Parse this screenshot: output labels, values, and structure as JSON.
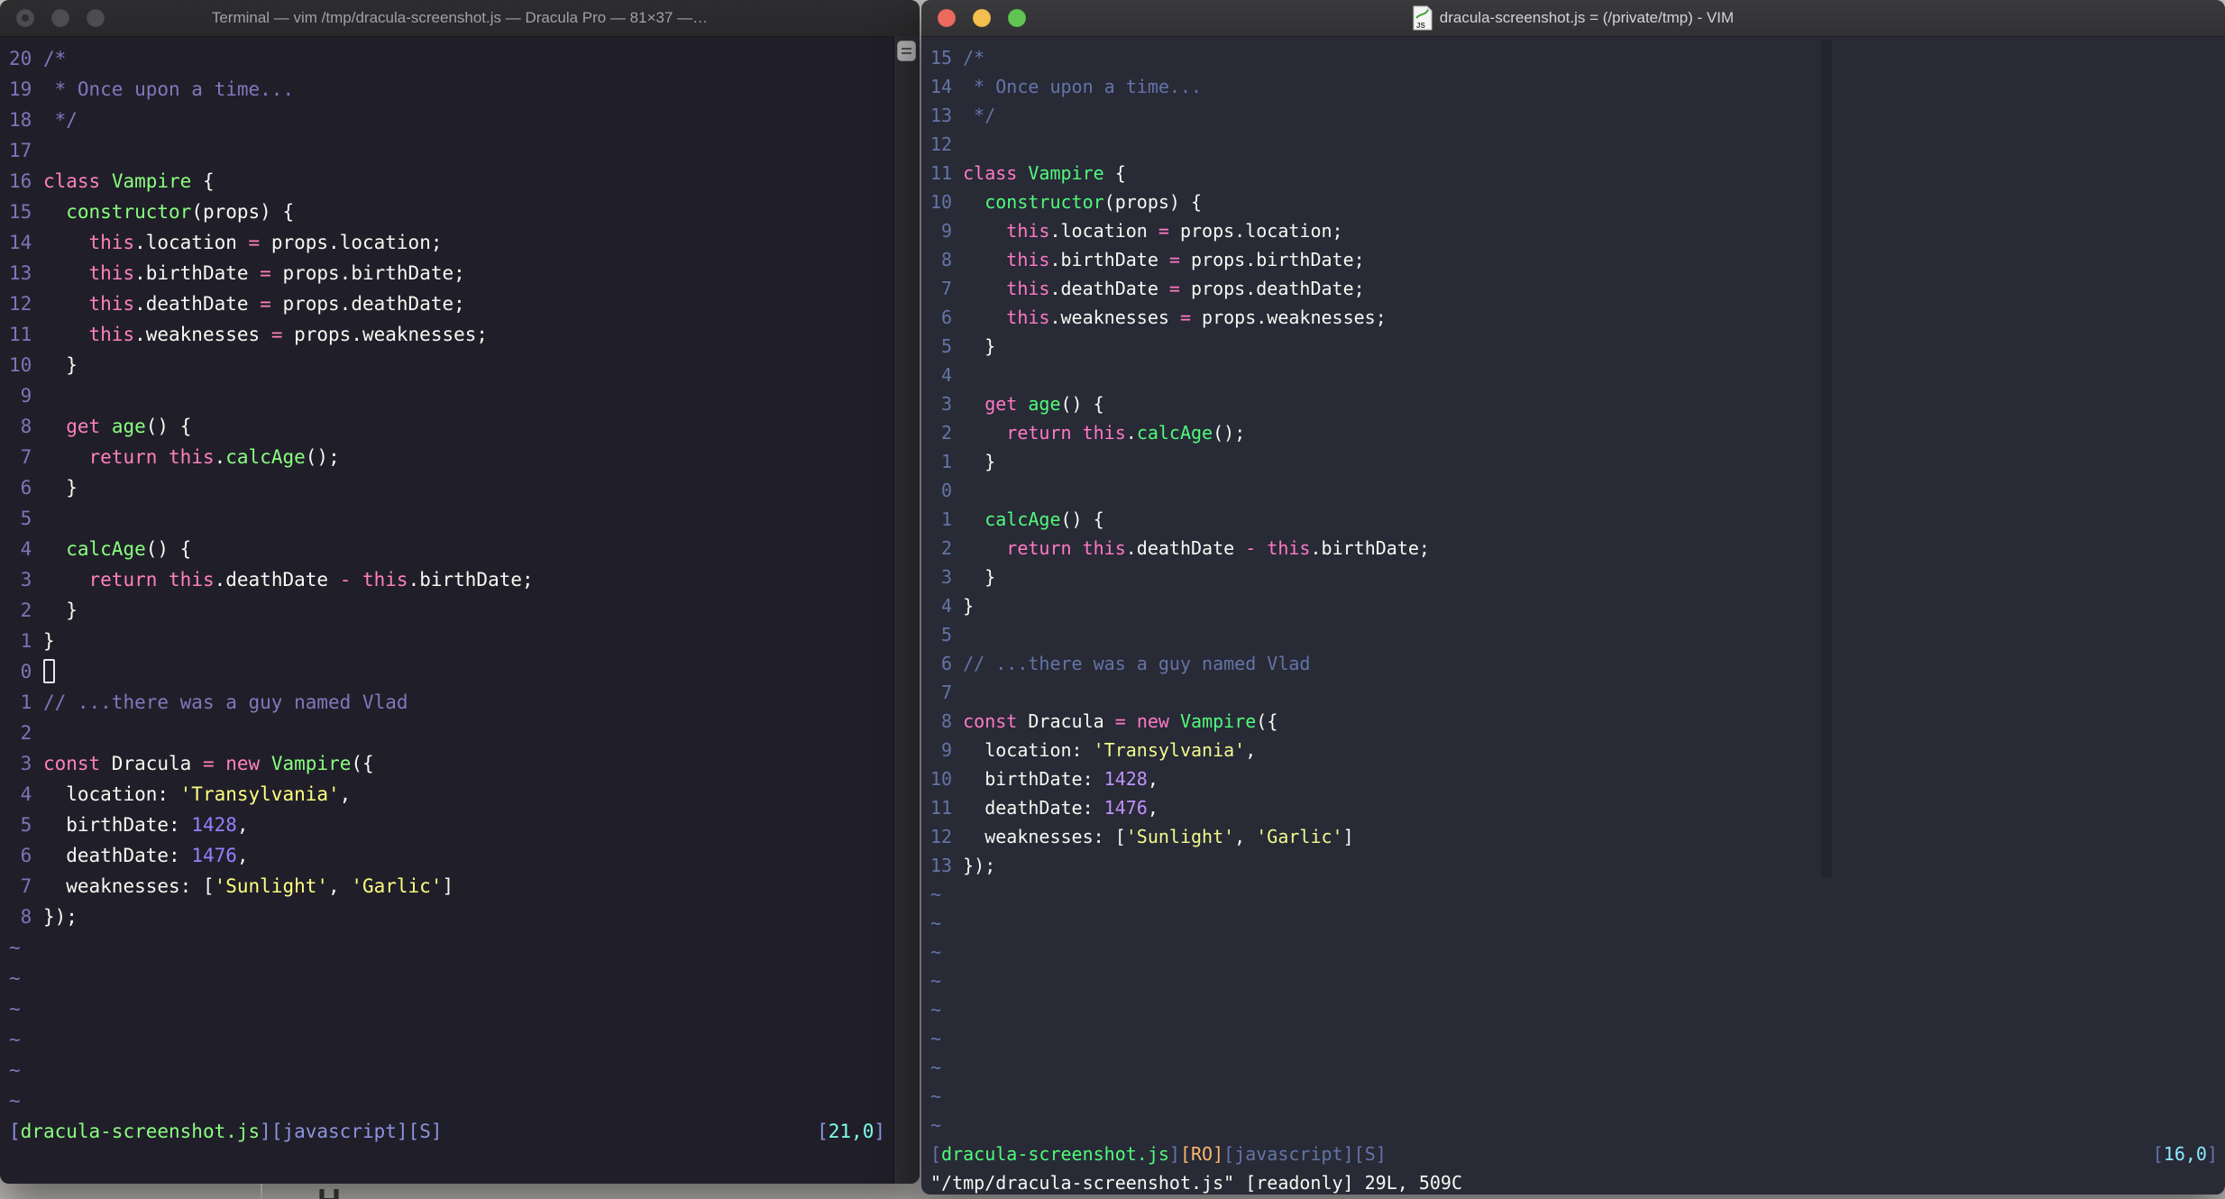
{
  "desktop": {
    "bg": "#c7c5c3",
    "partial_glyph": "H"
  },
  "file": {
    "name": "dracula-screenshot.js",
    "lines": [
      [
        [
          "com",
          "/*"
        ]
      ],
      [
        [
          "com",
          " * Once upon a time..."
        ]
      ],
      [
        [
          "com",
          " */"
        ]
      ],
      [],
      [
        [
          "kw",
          "class"
        ],
        [
          "fg",
          " "
        ],
        [
          "fn",
          "Vampire"
        ],
        [
          "fg",
          " {"
        ]
      ],
      [
        [
          "fg",
          "  "
        ],
        [
          "fn",
          "constructor"
        ],
        [
          "fg",
          "(props) {"
        ]
      ],
      [
        [
          "fg",
          "    "
        ],
        [
          "kw",
          "this"
        ],
        [
          "fg",
          ".location "
        ],
        [
          "kw",
          "="
        ],
        [
          "fg",
          " props.location;"
        ]
      ],
      [
        [
          "fg",
          "    "
        ],
        [
          "kw",
          "this"
        ],
        [
          "fg",
          ".birthDate "
        ],
        [
          "kw",
          "="
        ],
        [
          "fg",
          " props.birthDate;"
        ]
      ],
      [
        [
          "fg",
          "    "
        ],
        [
          "kw",
          "this"
        ],
        [
          "fg",
          ".deathDate "
        ],
        [
          "kw",
          "="
        ],
        [
          "fg",
          " props.deathDate;"
        ]
      ],
      [
        [
          "fg",
          "    "
        ],
        [
          "kw",
          "this"
        ],
        [
          "fg",
          ".weaknesses "
        ],
        [
          "kw",
          "="
        ],
        [
          "fg",
          " props.weaknesses;"
        ]
      ],
      [
        [
          "fg",
          "  }"
        ]
      ],
      [],
      [
        [
          "fg",
          "  "
        ],
        [
          "kw",
          "get"
        ],
        [
          "fg",
          " "
        ],
        [
          "fn",
          "age"
        ],
        [
          "fg",
          "() {"
        ]
      ],
      [
        [
          "fg",
          "    "
        ],
        [
          "kw",
          "return"
        ],
        [
          "fg",
          " "
        ],
        [
          "kw",
          "this"
        ],
        [
          "fg",
          "."
        ],
        [
          "fn",
          "calcAge"
        ],
        [
          "fg",
          "();"
        ]
      ],
      [
        [
          "fg",
          "  }"
        ]
      ],
      [],
      [
        [
          "fg",
          "  "
        ],
        [
          "fn",
          "calcAge"
        ],
        [
          "fg",
          "() {"
        ]
      ],
      [
        [
          "fg",
          "    "
        ],
        [
          "kw",
          "return"
        ],
        [
          "fg",
          " "
        ],
        [
          "kw",
          "this"
        ],
        [
          "fg",
          ".deathDate "
        ],
        [
          "kw",
          "-"
        ],
        [
          "fg",
          " "
        ],
        [
          "kw",
          "this"
        ],
        [
          "fg",
          ".birthDate;"
        ]
      ],
      [
        [
          "fg",
          "  }"
        ]
      ],
      [
        [
          "fg",
          "}"
        ]
      ],
      [],
      [
        [
          "com",
          "// ...there was a guy named Vlad"
        ]
      ],
      [],
      [
        [
          "kw",
          "const"
        ],
        [
          "fg",
          " Dracula "
        ],
        [
          "kw",
          "="
        ],
        [
          "fg",
          " "
        ],
        [
          "kw",
          "new"
        ],
        [
          "fg",
          " "
        ],
        [
          "fn",
          "Vampire"
        ],
        [
          "fg",
          "({"
        ]
      ],
      [
        [
          "fg",
          "  location: "
        ],
        [
          "str",
          "'Transylvania'"
        ],
        [
          "fg",
          ","
        ]
      ],
      [
        [
          "fg",
          "  birthDate: "
        ],
        [
          "num",
          "1428"
        ],
        [
          "fg",
          ","
        ]
      ],
      [
        [
          "fg",
          "  deathDate: "
        ],
        [
          "num",
          "1476"
        ],
        [
          "fg",
          ","
        ]
      ],
      [
        [
          "fg",
          "  weaknesses: ["
        ],
        [
          "str",
          "'Sunlight'"
        ],
        [
          "fg",
          ", "
        ],
        [
          "str",
          "'Garlic'"
        ],
        [
          "fg",
          "]"
        ]
      ],
      [
        [
          "fg",
          "});"
        ]
      ]
    ]
  },
  "left_window": {
    "app": "Terminal",
    "title": "Terminal — vim /tmp/dracula-screenshot.js — Dracula Pro — 81×37 —…",
    "theme": "Dracula Pro",
    "bg": "#201f29",
    "traffic_lights": {
      "close": "#4d4d4f",
      "minimize": "#4d4d4f",
      "zoom": "#4d4d4f",
      "close_dot": true
    },
    "cursor_line": 21,
    "cursor_col": 0,
    "cursor_style": "hollow",
    "tildes": 6,
    "palette": {
      "ln": "#7d75b8",
      "com": "#8078bd",
      "kw": "#ff80bf",
      "fn": "#8aff80",
      "fg": "#f8f8f2",
      "str": "#ffff80",
      "num": "#9580ff",
      "tilde": "#7d75b8"
    },
    "status_palette": {
      "pun": "#8d93e0",
      "file": "#8aff80",
      "meta": "#8d93e0",
      "pos": "#80ffea",
      "cmd": "#f8f8f2"
    },
    "status_left": [
      [
        "pun",
        "["
      ],
      [
        "file",
        "dracula-screenshot.js"
      ],
      [
        "pun",
        "]["
      ],
      [
        "meta",
        "javascript"
      ],
      [
        "pun",
        "]["
      ],
      [
        "meta",
        "S"
      ],
      [
        "pun",
        "]"
      ]
    ],
    "status_right": [
      [
        "pun",
        "["
      ],
      [
        "pos",
        "21,0"
      ],
      [
        "pun",
        "]"
      ]
    ],
    "cmd_line": ""
  },
  "right_window": {
    "app": "MacVim",
    "title": "dracula-screenshot.js = (/private/tmp) - VIM",
    "theme": "Dracula",
    "bg": "#282a36",
    "traffic_lights": {
      "close": "#ed6a5e",
      "minimize": "#f4bf4f",
      "zoom": "#61c454",
      "close_dot": false
    },
    "cursor_line": 16,
    "cursor_col": 0,
    "cursor_style": "none",
    "tildes": 9,
    "palette": {
      "ln": "#6474a6",
      "com": "#6474a6",
      "kw": "#ff79c6",
      "fn": "#50fa7b",
      "fg": "#f8f8f2",
      "str": "#f1fa8c",
      "num": "#bd93f9",
      "tilde": "#6474a6"
    },
    "status_palette": {
      "pun": "#6474a6",
      "file": "#50fa7b",
      "ro": "#ffb86c",
      "meta": "#6474a6",
      "pos": "#8be9fd",
      "cmd": "#f8f8f2"
    },
    "status_left": [
      [
        "pun",
        "["
      ],
      [
        "file",
        "dracula-screenshot.js"
      ],
      [
        "pun",
        "]"
      ],
      [
        "ro",
        "[RO]"
      ],
      [
        "pun",
        "["
      ],
      [
        "meta",
        "javascript"
      ],
      [
        "pun",
        "]["
      ],
      [
        "meta",
        "S"
      ],
      [
        "pun",
        "]"
      ]
    ],
    "status_right": [
      [
        "pun",
        "["
      ],
      [
        "pos",
        "16,0"
      ],
      [
        "pun",
        "]"
      ]
    ],
    "cmd_line": "\"/tmp/dracula-screenshot.js\" [readonly] 29L, 509C"
  }
}
